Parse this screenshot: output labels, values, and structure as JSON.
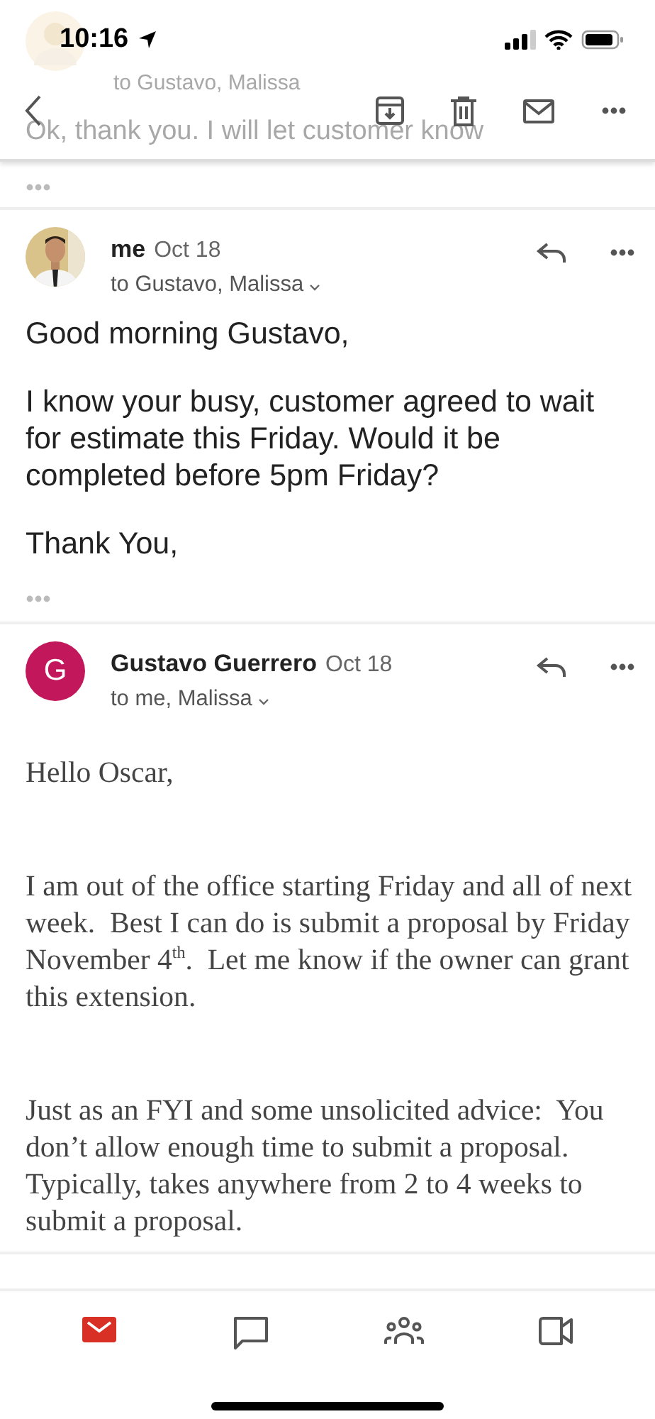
{
  "status_bar": {
    "time": "10:16"
  },
  "previous_message": {
    "recipients": "to Gustavo, Malissa",
    "snippet": "Ok, thank you. I will let customer know"
  },
  "messages": [
    {
      "sender": "me",
      "date": "Oct 18",
      "recipients": "to Gustavo, Malissa",
      "avatar": {
        "kind": "picture"
      },
      "kind": "plain",
      "paragraphs": [
        "Good morning Gustavo,",
        "I know your busy, customer agreed to wait for estimate this Friday. Would it be completed before 5pm Friday?",
        "Thank You,"
      ]
    },
    {
      "sender": "Gustavo Guerrero",
      "date": "Oct 18",
      "recipients": "to me, Malissa",
      "avatar": {
        "kind": "letter",
        "letter": "G",
        "color": "#c2185b"
      },
      "kind": "formatted",
      "paragraphs": [
        "Hello Oscar,",
        "I am out of the office starting Friday and all of next week.  Best I can do is submit a proposal by Friday November 4$^{th}$.  Let me know if the owner can grant this extension.",
        "Just as an FYI and some unsolicited advice:  You don’t allow enough time to submit a proposal.  Typically, takes anywhere from 2 to 4 weeks to submit a proposal."
      ]
    }
  ],
  "nav": [
    {
      "kind": "mail",
      "selected": true
    },
    {
      "kind": "chat",
      "selected": false
    },
    {
      "kind": "spaces",
      "selected": false
    },
    {
      "kind": "meet",
      "selected": false
    }
  ]
}
